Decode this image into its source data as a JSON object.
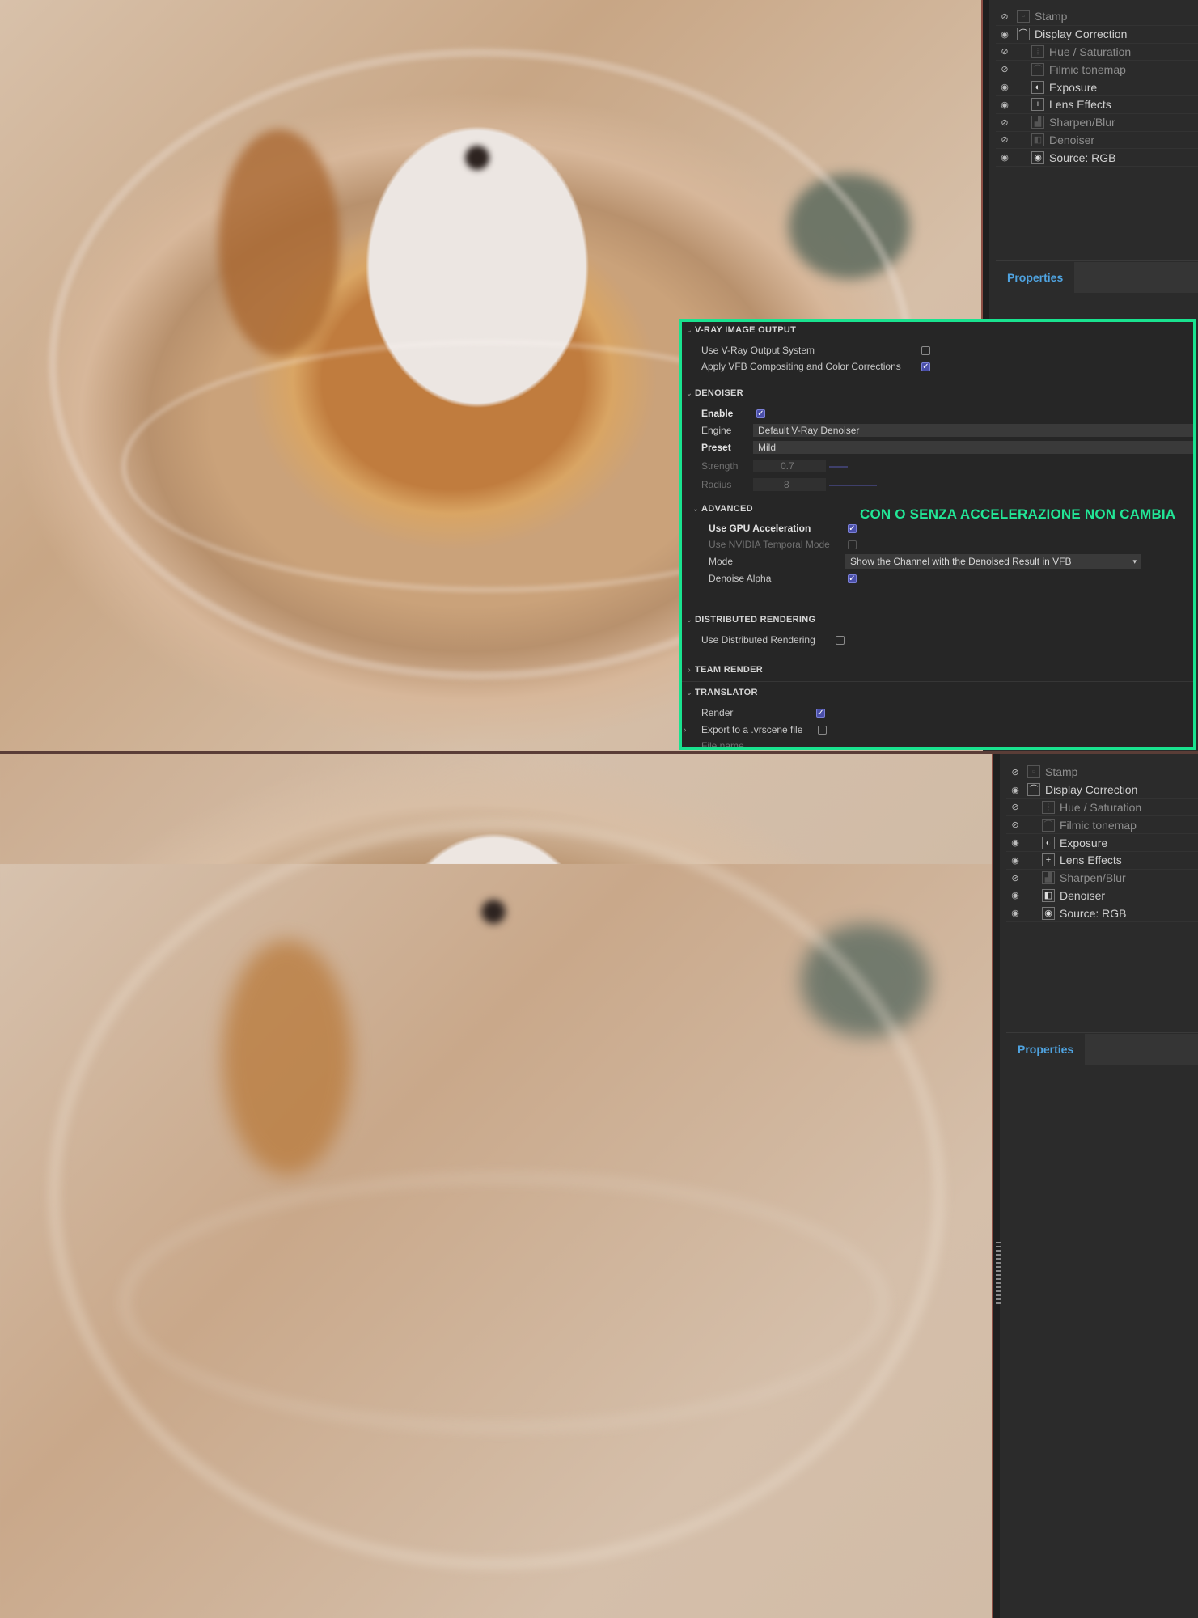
{
  "layers_top": [
    {
      "label": "Stamp",
      "visible": false,
      "indent": false,
      "icon": "stamp-icon",
      "glyph": "▫"
    },
    {
      "label": "Display Correction",
      "visible": true,
      "indent": false,
      "icon": "curve-icon",
      "glyph": "⌒"
    },
    {
      "label": "Hue / Saturation",
      "visible": false,
      "indent": true,
      "icon": "bars-icon",
      "glyph": "⦙"
    },
    {
      "label": "Filmic tonemap",
      "visible": false,
      "indent": true,
      "icon": "curve-icon",
      "glyph": "⌒"
    },
    {
      "label": "Exposure",
      "visible": true,
      "indent": true,
      "icon": "exposure-icon",
      "glyph": "◐"
    },
    {
      "label": "Lens Effects",
      "visible": true,
      "indent": true,
      "icon": "plus-icon",
      "glyph": "+"
    },
    {
      "label": "Sharpen/Blur",
      "visible": false,
      "indent": true,
      "icon": "sharpen-icon",
      "glyph": "▟"
    },
    {
      "label": "Denoiser",
      "visible": false,
      "indent": true,
      "icon": "denoiser-icon",
      "glyph": "◧"
    },
    {
      "label": "Source: RGB",
      "visible": true,
      "indent": true,
      "icon": "rgb-icon",
      "glyph": "◉"
    }
  ],
  "layers_bottom": [
    {
      "label": "Stamp",
      "visible": false,
      "indent": false,
      "icon": "stamp-icon",
      "glyph": "▫"
    },
    {
      "label": "Display Correction",
      "visible": true,
      "indent": false,
      "icon": "curve-icon",
      "glyph": "⌒"
    },
    {
      "label": "Hue / Saturation",
      "visible": false,
      "indent": true,
      "icon": "bars-icon",
      "glyph": "⦙"
    },
    {
      "label": "Filmic tonemap",
      "visible": false,
      "indent": true,
      "icon": "curve-icon",
      "glyph": "⌒"
    },
    {
      "label": "Exposure",
      "visible": true,
      "indent": true,
      "icon": "exposure-icon",
      "glyph": "◐"
    },
    {
      "label": "Lens Effects",
      "visible": true,
      "indent": true,
      "icon": "plus-icon",
      "glyph": "+"
    },
    {
      "label": "Sharpen/Blur",
      "visible": false,
      "indent": true,
      "icon": "sharpen-icon",
      "glyph": "▟"
    },
    {
      "label": "Denoiser",
      "visible": true,
      "indent": true,
      "icon": "denoiser-icon",
      "glyph": "◧"
    },
    {
      "label": "Source: RGB",
      "visible": true,
      "indent": true,
      "icon": "rgb-icon",
      "glyph": "◉"
    }
  ],
  "properties_tab": "Properties",
  "vray": {
    "image_output": {
      "title": "V-RAY IMAGE OUTPUT",
      "use_output_system": {
        "label": "Use V-Ray Output System",
        "checked": false
      },
      "apply_vfb": {
        "label": "Apply VFB Compositing and Color Corrections",
        "checked": true
      }
    },
    "denoiser": {
      "title": "DENOISER",
      "enable": {
        "label": "Enable",
        "checked": true
      },
      "engine": {
        "label": "Engine",
        "value": "Default V-Ray Denoiser"
      },
      "preset": {
        "label": "Preset",
        "value": "Mild"
      },
      "strength": {
        "label": "Strength",
        "value": "0.7",
        "fraction": 0.04
      },
      "radius": {
        "label": "Radius",
        "value": "8",
        "fraction": 0.1
      }
    },
    "advanced": {
      "title": "ADVANCED",
      "gpu": {
        "label": "Use GPU Acceleration",
        "checked": true
      },
      "nvidia": {
        "label": "Use NVIDIA Temporal Mode",
        "checked": false
      },
      "mode": {
        "label": "Mode",
        "value": "Show the Channel with the Denoised Result in VFB"
      },
      "alpha": {
        "label": "Denoise Alpha",
        "checked": true
      }
    },
    "distributed": {
      "title": "DISTRIBUTED RENDERING",
      "use": {
        "label": "Use Distributed Rendering",
        "checked": false
      }
    },
    "team_render": {
      "title": "TEAM RENDER"
    },
    "translator": {
      "title": "TRANSLATOR",
      "render": {
        "label": "Render",
        "checked": true
      },
      "export": {
        "label": "Export to a .vrscene file",
        "checked": false
      },
      "file_name": {
        "label": "File name"
      }
    }
  },
  "annotation": "CON O SENZA ACCELERAZIONE NON CAMBIA",
  "colors": {
    "highlight": "#19e28f",
    "annotation": "#22e596",
    "accent": "#4fa3e0",
    "checkbox_on": "#4a4fa8"
  }
}
